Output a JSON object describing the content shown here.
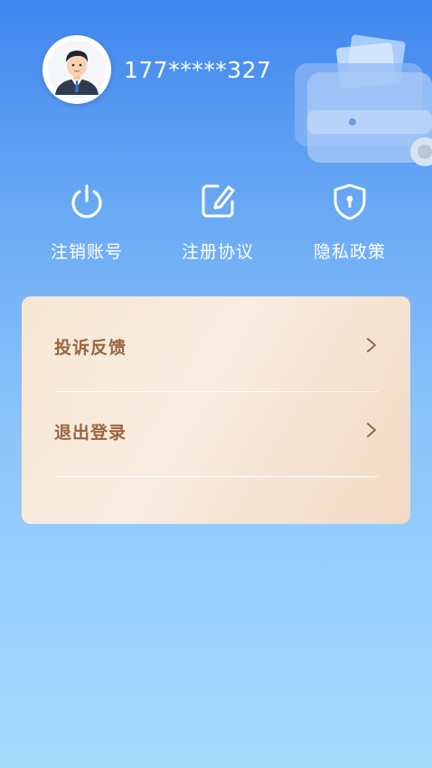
{
  "profile": {
    "phone": "177*****327",
    "avatar_icon": "user-avatar"
  },
  "actions": [
    {
      "label": "注销账号",
      "icon": "power-icon"
    },
    {
      "label": "注册协议",
      "icon": "edit-icon"
    },
    {
      "label": "隐私政策",
      "icon": "shield-lock-icon"
    }
  ],
  "menu": {
    "items": [
      {
        "label": "投诉反馈"
      },
      {
        "label": "退出登录"
      }
    ]
  },
  "colors": {
    "background_top": "#3f86ee",
    "background_bottom": "#a6dbfe",
    "card_text": "#9a6641"
  }
}
